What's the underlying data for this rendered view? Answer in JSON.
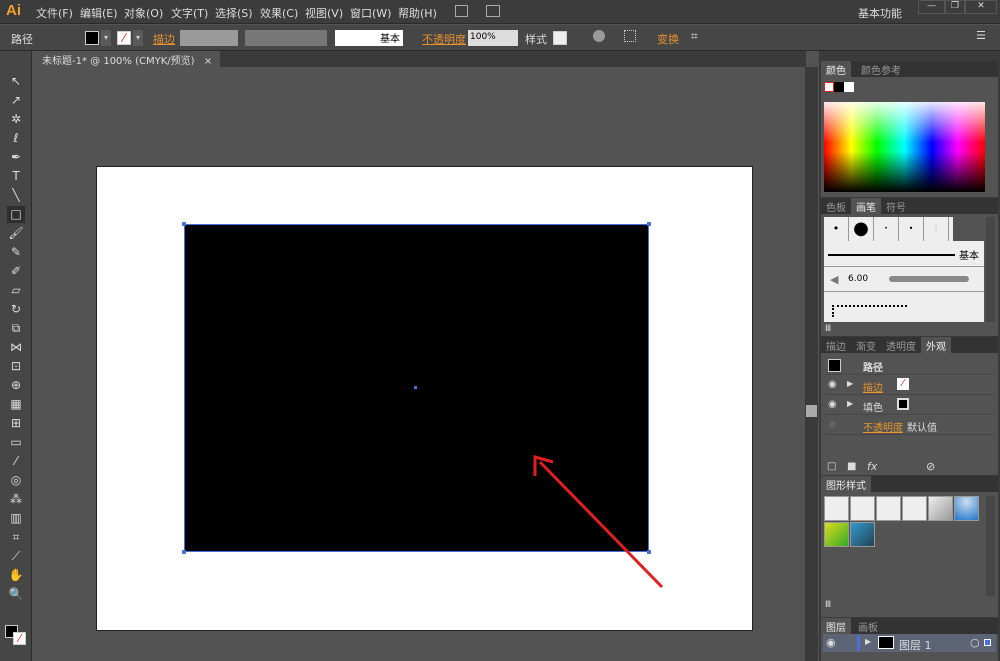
{
  "app": {
    "logo": "Ai"
  },
  "menu": [
    "文件(F)",
    "编辑(E)",
    "对象(O)",
    "文字(T)",
    "选择(S)",
    "效果(C)",
    "视图(V)",
    "窗口(W)",
    "帮助(H)"
  ],
  "workspace": "基本功能",
  "control": {
    "selection": "路径",
    "stroke_label": "描边",
    "stroke_profile": "基本",
    "opacity_label": "不透明度",
    "opacity_value": "100%",
    "style_label": "样式",
    "transform_label": "变换"
  },
  "document": {
    "tab": "未标题-1* @ 100% (CMYK/预览)"
  },
  "color_panel": {
    "tabs": [
      "颜色",
      "颜色参考"
    ]
  },
  "brush_panel": {
    "tabs": [
      "色板",
      "画笔",
      "符号"
    ],
    "basic": "基本",
    "size": "6.00"
  },
  "appearance_panel": {
    "tabs": [
      "描边",
      "渐变",
      "透明度",
      "外观"
    ],
    "title": "路径",
    "stroke": "描边",
    "fill": "填色",
    "opacity": "不透明度",
    "opacity_value": "默认值"
  },
  "graphic_styles": {
    "title": "图形样式"
  },
  "layers_panel": {
    "tabs": [
      "图层",
      "画板"
    ],
    "layer": "图层 1"
  },
  "colors": {
    "accent": "#e8932d",
    "selection": "#4a6fd8",
    "arrow": "#e02020"
  }
}
